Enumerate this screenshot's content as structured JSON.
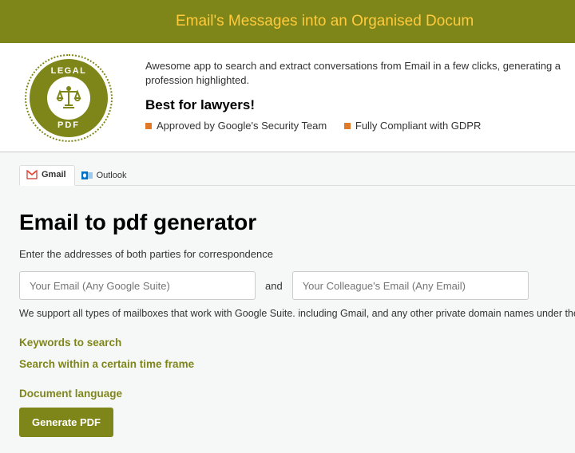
{
  "banner": {
    "text": "Email's Messages into an Organised Docum"
  },
  "logo": {
    "top_text": "LEGAL",
    "bottom_text": "PDF"
  },
  "header": {
    "tagline": "Awesome app to search and extract conversations from Email in a few clicks, generating a profession highlighted.",
    "best": "Best for lawyers!",
    "badge1": "Approved by Google's Security Team",
    "badge2": "Fully Compliant with GDPR"
  },
  "tabs": {
    "gmail": "Gmail",
    "outlook": "Outlook"
  },
  "main": {
    "title": "Email to pdf generator",
    "instruction": "Enter the addresses of both parties for correspondence",
    "email1_placeholder": "Your Email (Any Google Suite)",
    "and": "and",
    "email2_placeholder": "Your Colleague's Email (Any Email)",
    "support_note": "We support all types of mailboxes that work with Google Suite. including Gmail, and any other private domain names under the Google S",
    "keywords_link": "Keywords to search",
    "timeframe_link": "Search within a certain time frame",
    "language_link": "Document language",
    "generate_btn": "Generate PDF"
  }
}
